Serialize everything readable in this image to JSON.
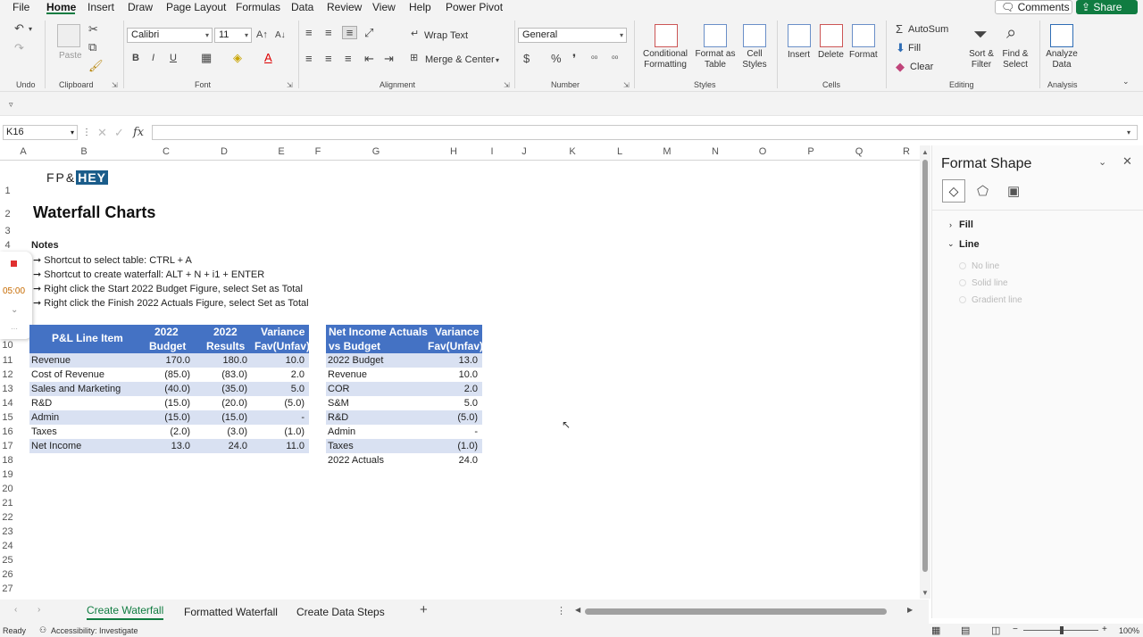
{
  "menu": {
    "items": [
      "File",
      "Home",
      "Insert",
      "Draw",
      "Page Layout",
      "Formulas",
      "Data",
      "Review",
      "View",
      "Help",
      "Power Pivot"
    ],
    "active": "Home",
    "comments_label": "Comments",
    "share_label": "Share"
  },
  "ribbon": {
    "undo_label": "Undo",
    "clipboard_label": "Clipboard",
    "paste_label": "Paste",
    "font_name": "Calibri",
    "font_size": "11",
    "font_label": "Font",
    "wrap_text": "Wrap Text",
    "merge_center": "Merge & Center",
    "alignment_label": "Alignment",
    "number_format": "General",
    "number_label": "Number",
    "conditional_formatting": [
      "Conditional",
      "Formatting"
    ],
    "format_as_table": [
      "Format as",
      "Table"
    ],
    "cell_styles": [
      "Cell",
      "Styles"
    ],
    "styles_label": "Styles",
    "insert": "Insert",
    "delete": "Delete",
    "format": "Format",
    "cells_label": "Cells",
    "autosum": "AutoSum",
    "fill": "Fill",
    "clear": "Clear",
    "sort_filter": [
      "Sort &",
      "Filter"
    ],
    "find_select": [
      "Find &",
      "Select"
    ],
    "editing_label": "Editing",
    "analyze_data": [
      "Analyze",
      "Data"
    ],
    "analysis_label": "Analysis"
  },
  "formula_bar": {
    "name_box": "K16",
    "fx": "fx",
    "value": ""
  },
  "columns": [
    "A",
    "B",
    "C",
    "D",
    "E",
    "F",
    "G",
    "H",
    "I",
    "J",
    "K",
    "L",
    "M",
    "N",
    "O",
    "P",
    "Q",
    "R"
  ],
  "rows": [
    "1",
    "2",
    "3",
    "4",
    "",
    "",
    "",
    "",
    "",
    "10",
    "11",
    "12",
    "13",
    "14",
    "15",
    "16",
    "17",
    "18",
    "19",
    "20",
    "21",
    "22",
    "23",
    "24",
    "25",
    "26",
    "27"
  ],
  "sheet": {
    "logo_left": "FP&",
    "logo_right": "HEY",
    "title": "Waterfall Charts",
    "notes_heading": "Notes",
    "notes": [
      "➞ Shortcut to select table: CTRL + A",
      "➞ Shortcut to create waterfall: ALT + N + i1 + ENTER",
      "➞ Right click the Start 2022 Budget Figure, select Set as Total",
      "➞ Right click the Finish 2022 Actuals Figure, select Set as Total"
    ],
    "timer": "05:00"
  },
  "pl_table": {
    "headers": [
      "P&L Line Item",
      "2022\nBudget",
      "2022\nResults",
      "Variance\nFav(Unfav)"
    ],
    "h1": [
      "P&L Line Item",
      "2022",
      "2022",
      "Variance"
    ],
    "h2": [
      "",
      "Budget",
      "Results",
      "Fav(Unfav)"
    ],
    "rows": [
      [
        "Revenue",
        "170.0",
        "180.0",
        "10.0"
      ],
      [
        "Cost of Revenue",
        "(85.0)",
        "(83.0)",
        "2.0"
      ],
      [
        "Sales and Marketing",
        "(40.0)",
        "(35.0)",
        "5.0"
      ],
      [
        "R&D",
        "(15.0)",
        "(20.0)",
        "(5.0)"
      ],
      [
        "Admin",
        "(15.0)",
        "(15.0)",
        "-"
      ],
      [
        "Taxes",
        "(2.0)",
        "(3.0)",
        "(1.0)"
      ],
      [
        "Net Income",
        "13.0",
        "24.0",
        "11.0"
      ]
    ]
  },
  "ni_table": {
    "h1": [
      "Net Income Actuals",
      "Variance"
    ],
    "h2": [
      "vs Budget",
      "Fav(Unfav)"
    ],
    "rows": [
      [
        "2022 Budget",
        "13.0"
      ],
      [
        "Revenue",
        "10.0"
      ],
      [
        "COR",
        "2.0"
      ],
      [
        "S&M",
        "5.0"
      ],
      [
        "R&D",
        "(5.0)"
      ],
      [
        "Admin",
        "-"
      ],
      [
        "Taxes",
        "(1.0)"
      ],
      [
        "2022 Actuals",
        "24.0"
      ]
    ]
  },
  "pane": {
    "title": "Format Shape",
    "fill": "Fill",
    "line": "Line",
    "options": [
      "No line",
      "Solid line",
      "Gradient line"
    ]
  },
  "tabs": [
    "Create Waterfall",
    "Formatted Waterfall",
    "Create Data Steps"
  ],
  "status": {
    "ready": "Ready",
    "accessibility": "Accessibility: Investigate",
    "zoom": "100%"
  }
}
